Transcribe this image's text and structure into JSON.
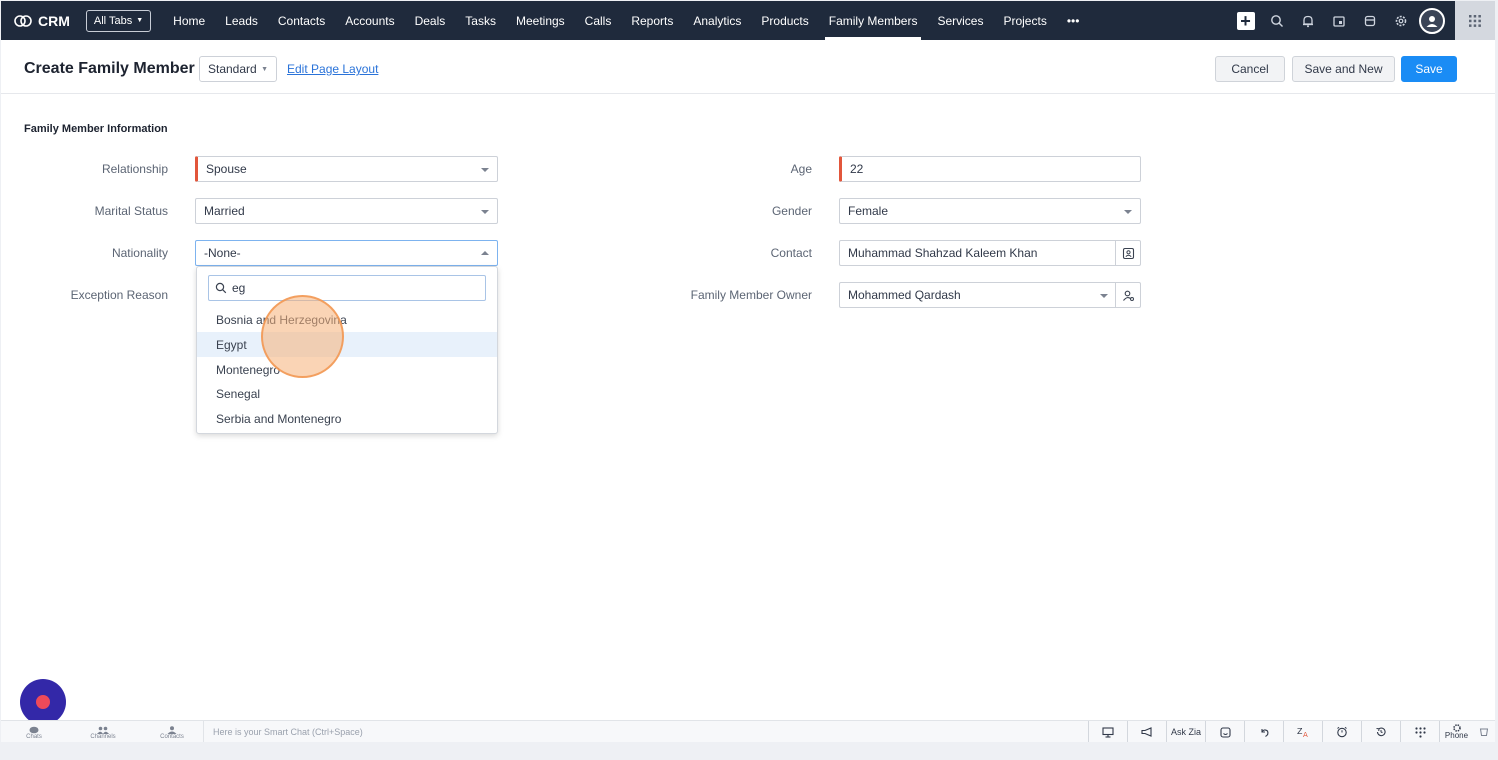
{
  "app": {
    "brand": "CRM",
    "all_tabs": "All Tabs"
  },
  "nav": {
    "tabs": [
      "Home",
      "Leads",
      "Contacts",
      "Accounts",
      "Deals",
      "Tasks",
      "Meetings",
      "Calls",
      "Reports",
      "Analytics",
      "Products",
      "Family Members",
      "Services",
      "Projects"
    ],
    "active": "Family Members",
    "more": "•••",
    "icons": [
      "plus-icon",
      "search-icon",
      "bell-icon",
      "calendar-icon",
      "store-icon",
      "gear-icon",
      "avatar",
      "apps-grid-icon"
    ]
  },
  "header": {
    "title": "Create Family Member",
    "layout": "Standard",
    "edit_layout": "Edit Page Layout",
    "cancel": "Cancel",
    "save_new": "Save and New",
    "save": "Save"
  },
  "section": {
    "title": "Family Member Information"
  },
  "fields": {
    "relationship": {
      "label": "Relationship",
      "value": "Spouse"
    },
    "marital_status": {
      "label": "Marital Status",
      "value": "Married"
    },
    "nationality": {
      "label": "Nationality",
      "value": "-None-"
    },
    "exception_reason": {
      "label": "Exception Reason"
    },
    "age": {
      "label": "Age",
      "value": "22"
    },
    "gender": {
      "label": "Gender",
      "value": "Female"
    },
    "contact": {
      "label": "Contact",
      "value": "Muhammad Shahzad Kaleem Khan"
    },
    "owner": {
      "label": "Family Member Owner",
      "value": "Mohammed Qardash"
    }
  },
  "dropdown": {
    "search_value": "eg",
    "options": [
      "Bosnia and Herzegovina",
      "Egypt",
      "Montenegro",
      "Senegal",
      "Serbia and Montenegro"
    ],
    "highlighted": "Egypt"
  },
  "bottombar": {
    "left": [
      "Chats",
      "Channels",
      "Contacts"
    ],
    "smart_chat_placeholder": "Here is your Smart Chat (Ctrl+Space)",
    "ask_zia": "Ask Zia",
    "phone": "Phone"
  },
  "colors": {
    "nav_bg": "#1f2a3c",
    "accent": "#1a8cf5",
    "required": "#e2563b",
    "fab": "#3328a8"
  }
}
